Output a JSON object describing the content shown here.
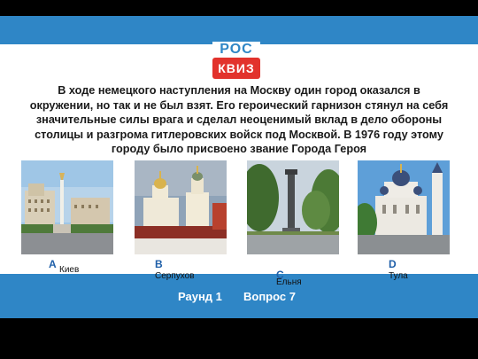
{
  "logo": {
    "top": "РОС",
    "bottom": "КВИЗ"
  },
  "question": "В ходе немецкого наступления на Москву один город оказался в окружении, но так и не был взят. Его героический гарнизон стянул на себя значительные силы врага и сделал неоценимый вклад в дело обороны столицы и разгрома гитлеровских войск под Москвой. В 1976 году этому городу было присвоено звание Города Героя",
  "options": [
    {
      "letter": "A",
      "name": "Киев"
    },
    {
      "letter": "B",
      "name": "Серпухов"
    },
    {
      "letter": "C",
      "name": "Ельня"
    },
    {
      "letter": "D",
      "name": "Тула"
    }
  ],
  "footer": {
    "round_label": "Раунд 1",
    "question_label": "Вопрос 7"
  },
  "colors": {
    "accent_blue": "#2f86c6",
    "logo_red": "#e2322c",
    "option_letter": "#1f5fa8"
  }
}
